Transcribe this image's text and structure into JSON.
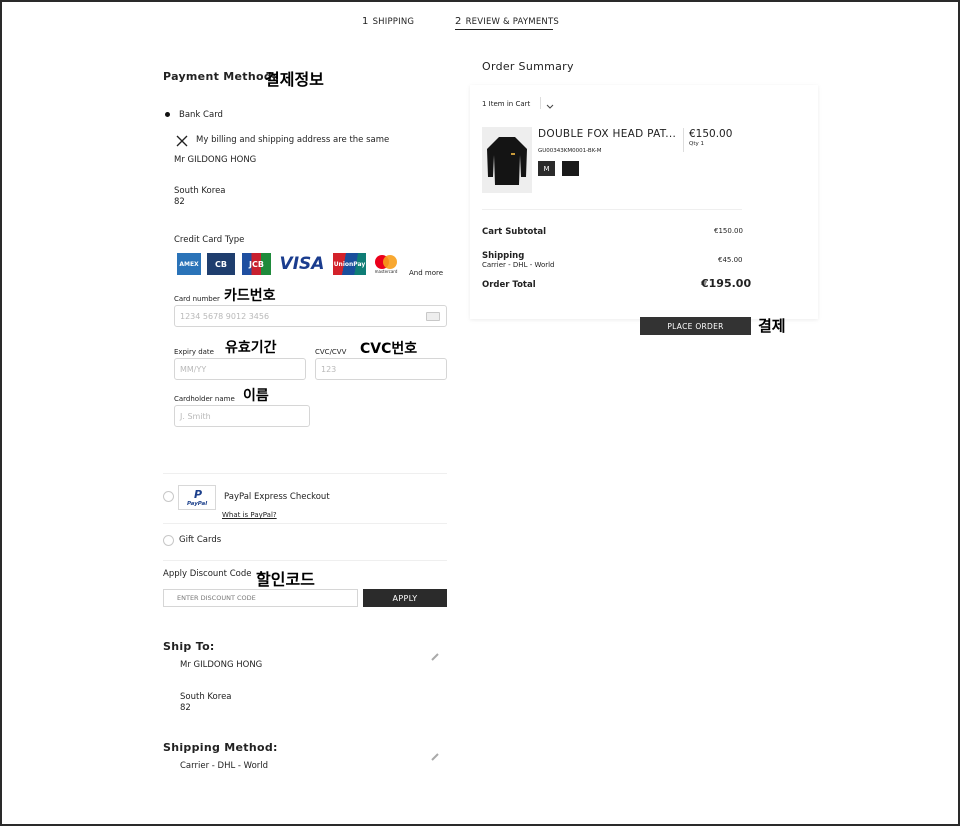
{
  "steps": [
    {
      "num": "1",
      "label": "SHIPPING"
    },
    {
      "num": "2",
      "label": "REVIEW & PAYMENTS"
    }
  ],
  "payment": {
    "heading": "Payment Method:",
    "annotation": "결제정보",
    "bank_card_label": "Bank Card",
    "same_address_label": "My billing and shipping address are the same",
    "name": "Mr GILDONG HONG",
    "country": "South Korea",
    "postal": "82",
    "card_type_label": "Credit Card Type",
    "card_logos": [
      "AMEX",
      "CB",
      "JCB",
      "VISA",
      "UnionPay",
      "mastercard"
    ],
    "and_more": "And more",
    "card_number_label": "Card number",
    "card_number_annotation": "카드번호",
    "card_number_placeholder": "1234 5678 9012 3456",
    "expiry_label": "Expiry date",
    "expiry_annotation": "유효기간",
    "expiry_placeholder": "MM/YY",
    "cvc_label": "CVC/CVV",
    "cvc_annotation": "CVC번호",
    "cvc_placeholder": "123",
    "holder_label": "Cardholder name",
    "holder_annotation": "이름",
    "holder_placeholder": "J. Smith",
    "paypal_label": "PayPal Express Checkout",
    "paypal_logo_text": "PayPal",
    "paypal_link": "What is PayPal?",
    "gift_cards_label": "Gift Cards",
    "discount_label": "Apply Discount Code",
    "discount_annotation": "할인코드",
    "discount_placeholder": "ENTER DISCOUNT CODE",
    "apply_button": "APPLY"
  },
  "ship_to": {
    "heading": "Ship To:",
    "name": "Mr GILDONG  HONG",
    "country": "South Korea",
    "postal": "82"
  },
  "shipping_method": {
    "heading": "Shipping Method:",
    "value": "Carrier - DHL - World"
  },
  "summary": {
    "heading": "Order Summary",
    "items_in_cart": "1 Item in Cart",
    "product_name": "DOUBLE FOX HEAD PAT...",
    "product_sku": "GU00343KM0001-BK-M",
    "product_price": "€150.00",
    "product_qty": "Qty 1",
    "size": "M",
    "color_swatch": "#1a1a1a",
    "cart_subtotal_label": "Cart Subtotal",
    "cart_subtotal": "€150.00",
    "shipping_label": "Shipping",
    "shipping_carrier": "Carrier - DHL - World",
    "shipping_value": "€45.00",
    "order_total_label": "Order Total",
    "order_total": "€195.00",
    "place_order_button": "PLACE ORDER",
    "place_order_annotation": "결제"
  }
}
